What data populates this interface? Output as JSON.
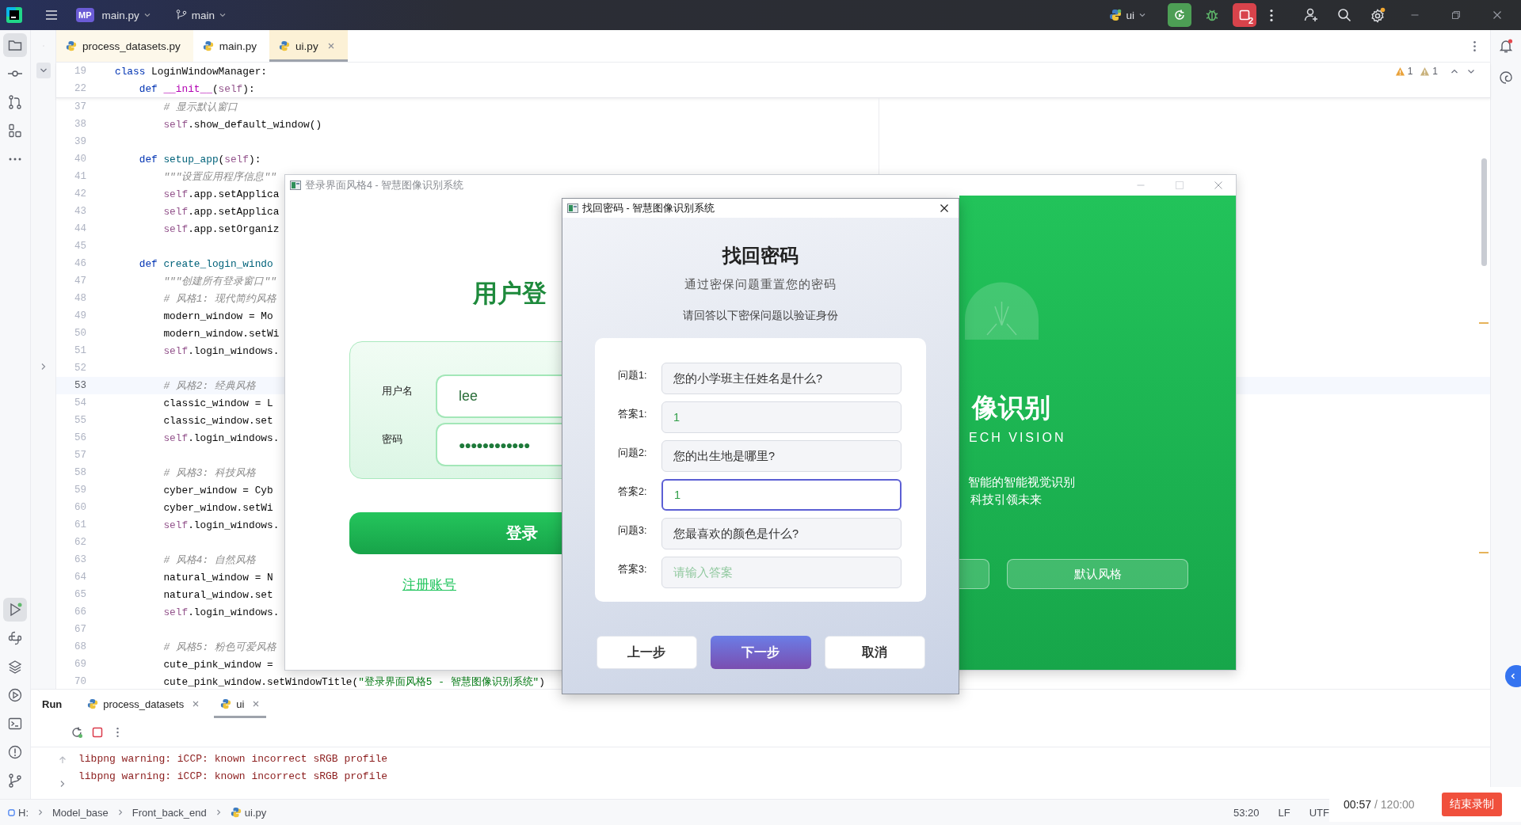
{
  "title_bar": {
    "project_badge": "MP",
    "project": "main.py",
    "branch": "main",
    "run_config": "ui",
    "stop_count": "2"
  },
  "left_toolbar": {
    "top": [
      {
        "kind": "project",
        "selected": true
      },
      {
        "kind": "commit",
        "selected": false
      },
      {
        "kind": "pull_requests",
        "selected": false
      },
      {
        "kind": "structure",
        "selected": false
      },
      {
        "kind": "more",
        "selected": false
      }
    ],
    "bottom": [
      {
        "kind": "run",
        "selected": true
      },
      {
        "kind": "python_console",
        "selected": false
      },
      {
        "kind": "layers",
        "selected": false
      },
      {
        "kind": "services",
        "selected": false
      },
      {
        "kind": "terminal",
        "selected": false
      },
      {
        "kind": "problems",
        "selected": false
      },
      {
        "kind": "git",
        "selected": false
      }
    ]
  },
  "editor_tabs": [
    {
      "label": "process_datasets.py",
      "selected": false
    },
    {
      "label": "main.py",
      "selected": false
    },
    {
      "label": "ui.py",
      "selected": true
    }
  ],
  "inspections": [
    {
      "kind": "warning",
      "count": "1"
    },
    {
      "kind": "weak_warning",
      "count": "1"
    }
  ],
  "sticky_lines": [
    {
      "number": "19",
      "tokens": [
        {
          "kind": "kw",
          "text": "class"
        },
        {
          "kind": "plain",
          "text": " LoginWindowManager:"
        }
      ]
    },
    {
      "number": "22",
      "tokens": [
        {
          "kind": "kw",
          "text": "    def"
        },
        {
          "kind": "magic",
          "text": " __init__"
        },
        {
          "kind": "plain",
          "text": "("
        },
        {
          "kind": "self",
          "text": "self"
        },
        {
          "kind": "plain",
          "text": "):"
        }
      ]
    }
  ],
  "code_lines": [
    {
      "number": "37",
      "current": false,
      "tokens": [
        {
          "kind": "comment",
          "text": "        # 显示默认窗口"
        }
      ]
    },
    {
      "number": "38",
      "current": false,
      "tokens": [
        {
          "kind": "self",
          "text": "        self"
        },
        {
          "kind": "plain",
          "text": ".show_default_window()"
        }
      ]
    },
    {
      "number": "39",
      "current": false
    },
    {
      "number": "40",
      "current": false,
      "tokens": [
        {
          "kind": "kw",
          "text": "    def"
        },
        {
          "kind": "fn",
          "text": " setup_app"
        },
        {
          "kind": "plain",
          "text": "("
        },
        {
          "kind": "self",
          "text": "self"
        },
        {
          "kind": "plain",
          "text": "):"
        }
      ]
    },
    {
      "number": "41",
      "current": false,
      "tokens": [
        {
          "kind": "comment",
          "text": "        \"\"\"设置应用程序信息\"\""
        }
      ]
    },
    {
      "number": "42",
      "current": false,
      "tokens": [
        {
          "kind": "self",
          "text": "        self"
        },
        {
          "kind": "plain",
          "text": ".app.setApplica"
        }
      ]
    },
    {
      "number": "43",
      "current": false,
      "tokens": [
        {
          "kind": "self",
          "text": "        self"
        },
        {
          "kind": "plain",
          "text": ".app.setApplica"
        }
      ]
    },
    {
      "number": "44",
      "current": false,
      "tokens": [
        {
          "kind": "self",
          "text": "        self"
        },
        {
          "kind": "plain",
          "text": ".app.setOrganiz"
        }
      ]
    },
    {
      "number": "45",
      "current": false
    },
    {
      "number": "46",
      "current": false,
      "tokens": [
        {
          "kind": "kw",
          "text": "    def"
        },
        {
          "kind": "fn",
          "text": " create_login_windo"
        }
      ]
    },
    {
      "number": "47",
      "current": false,
      "tokens": [
        {
          "kind": "comment",
          "text": "        \"\"\"创建所有登录窗口\"\""
        }
      ]
    },
    {
      "number": "48",
      "current": false,
      "tokens": [
        {
          "kind": "comment",
          "text": "        # 风格1: 现代简约风格"
        }
      ]
    },
    {
      "number": "49",
      "current": false,
      "tokens": [
        {
          "kind": "plain",
          "text": "        modern_window = Mo"
        }
      ]
    },
    {
      "number": "50",
      "current": false,
      "tokens": [
        {
          "kind": "plain",
          "text": "        modern_window.setWi"
        }
      ]
    },
    {
      "number": "51",
      "current": false,
      "tokens": [
        {
          "kind": "self",
          "text": "        self"
        },
        {
          "kind": "plain",
          "text": ".login_windows."
        }
      ]
    },
    {
      "number": "52",
      "current": false
    },
    {
      "number": "53",
      "current": true,
      "tokens": [
        {
          "kind": "comment",
          "text": "        # 风格2: 经典风格"
        }
      ]
    },
    {
      "number": "54",
      "current": false,
      "tokens": [
        {
          "kind": "plain",
          "text": "        classic_window = L"
        }
      ]
    },
    {
      "number": "55",
      "current": false,
      "tokens": [
        {
          "kind": "plain",
          "text": "        classic_window.set"
        }
      ]
    },
    {
      "number": "56",
      "current": false,
      "tokens": [
        {
          "kind": "self",
          "text": "        self"
        },
        {
          "kind": "plain",
          "text": ".login_windows."
        }
      ]
    },
    {
      "number": "57",
      "current": false
    },
    {
      "number": "58",
      "current": false,
      "tokens": [
        {
          "kind": "comment",
          "text": "        # 风格3: 科技风格"
        }
      ]
    },
    {
      "number": "59",
      "current": false,
      "tokens": [
        {
          "kind": "plain",
          "text": "        cyber_window = Cyb"
        }
      ]
    },
    {
      "number": "60",
      "current": false,
      "tokens": [
        {
          "kind": "plain",
          "text": "        cyber_window.setWi"
        }
      ]
    },
    {
      "number": "61",
      "current": false,
      "tokens": [
        {
          "kind": "self",
          "text": "        self"
        },
        {
          "kind": "plain",
          "text": ".login_windows."
        }
      ]
    },
    {
      "number": "62",
      "current": false
    },
    {
      "number": "63",
      "current": false,
      "tokens": [
        {
          "kind": "comment",
          "text": "        # 风格4: 自然风格"
        }
      ]
    },
    {
      "number": "64",
      "current": false,
      "tokens": [
        {
          "kind": "plain",
          "text": "        natural_window = N"
        }
      ]
    },
    {
      "number": "65",
      "current": false,
      "tokens": [
        {
          "kind": "plain",
          "text": "        natural_window.set"
        }
      ]
    },
    {
      "number": "66",
      "current": false,
      "tokens": [
        {
          "kind": "self",
          "text": "        self"
        },
        {
          "kind": "plain",
          "text": ".login_windows."
        }
      ]
    },
    {
      "number": "67",
      "current": false
    },
    {
      "number": "68",
      "current": false,
      "tokens": [
        {
          "kind": "comment",
          "text": "        # 风格5: 粉色可爱风格"
        }
      ]
    },
    {
      "number": "69",
      "current": false,
      "tokens": [
        {
          "kind": "plain",
          "text": "        cute_pink_window ="
        }
      ]
    },
    {
      "number": "70",
      "current": false,
      "tokens": [
        {
          "kind": "plain",
          "text": "        cute_pink_window.setWindowTitle("
        },
        {
          "kind": "str",
          "text": "\"登录界面风格5 - 智慧图像识别系统\""
        },
        {
          "kind": "plain",
          "text": ")"
        }
      ]
    }
  ],
  "login_window": {
    "title": "登录界面风格4 - 智慧图像识别系统",
    "heading": "用户登",
    "username_label": "用户名",
    "username": "lee",
    "password_label": "密码",
    "password": "●●●●●●●●●●●●",
    "login_button": "登录",
    "register_link": "注册账号",
    "brand_heading": "像识别",
    "brand_subtitle": "ECH VISION",
    "brand_lines": [
      "智能的智能视觉识别",
      "科技引领未来"
    ],
    "style_button": "默认风格"
  },
  "dialog": {
    "title": "找回密码 - 智慧图像识别系统",
    "heading": "找回密码",
    "subtitle": "通过密保问题重置您的密码",
    "instruction": "请回答以下密保问题以验证身份",
    "fields": [
      {
        "kind": "question",
        "label": "问题1:",
        "value": "您的小学班主任姓名是什么?",
        "focused": false
      },
      {
        "kind": "answer",
        "label": "答案1:",
        "value": "1",
        "focused": false
      },
      {
        "kind": "question",
        "label": "问题2:",
        "value": "您的出生地是哪里?",
        "focused": false
      },
      {
        "kind": "answer",
        "label": "答案2:",
        "value": "1",
        "focused": true
      },
      {
        "kind": "question",
        "label": "问题3:",
        "value": "您最喜欢的颜色是什么?",
        "focused": false
      },
      {
        "kind": "answer",
        "label": "答案3:",
        "placeholder": "请输入答案",
        "focused": false
      }
    ],
    "buttons": [
      {
        "kind": "secondary",
        "label": "上一步"
      },
      {
        "kind": "primary",
        "label": "下一步"
      },
      {
        "kind": "secondary",
        "label": "取消"
      }
    ]
  },
  "run_panel": {
    "title": "Run",
    "tabs": [
      {
        "label": "process_datasets",
        "selected": false
      },
      {
        "label": "ui",
        "selected": true
      }
    ],
    "output": [
      "libpng warning: iCCP: known incorrect sRGB profile",
      "libpng warning: iCCP: known incorrect sRGB profile"
    ]
  },
  "status_bar": {
    "path": [
      {
        "kind": "drive",
        "label": "H:"
      },
      {
        "kind": "folder",
        "label": "Model_base"
      },
      {
        "kind": "folder",
        "label": "Front_back_end"
      },
      {
        "kind": "file",
        "label": "ui.py"
      }
    ],
    "position": "53:20",
    "line_ending": "LF",
    "encoding": "UTF"
  },
  "recording": {
    "elapsed": "00:57",
    "limit": "/ 120:00",
    "stop_button": "结束录制"
  }
}
